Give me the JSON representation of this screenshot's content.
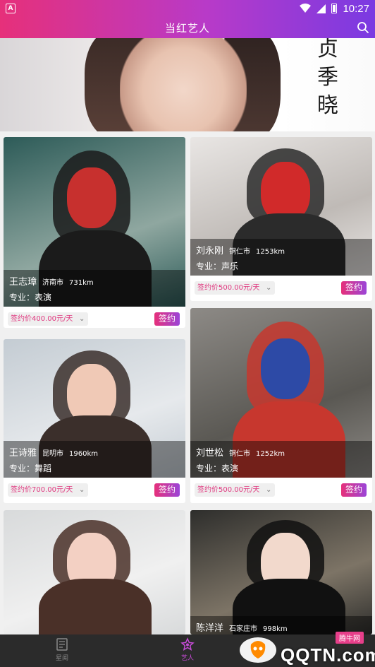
{
  "status_bar": {
    "time": "10:27"
  },
  "app_bar": {
    "title": "当红艺人"
  },
  "banner": {
    "text": "贞\n季\n晓",
    "dots": 4,
    "active_dot": 0
  },
  "cards": [
    {
      "name": "王志璋",
      "city": "济南市",
      "distance": "731km",
      "category_label": "专业：表演",
      "price": "签约价400.00元/天",
      "sign_label": "签约",
      "colors": [
        "#2d5b58",
        "#8fa7a0",
        "#c7302e",
        "#1b1b1b"
      ]
    },
    {
      "name": "刘永刚",
      "city": "铜仁市",
      "distance": "1253km",
      "category_label": "专业：声乐",
      "price": "签约价500.00元/天",
      "sign_label": "签约",
      "colors": [
        "#e9e6e4",
        "#bfbab6",
        "#d12a2a",
        "#2b2b2b"
      ]
    },
    {
      "name": "王诗雅",
      "city": "昆明市",
      "distance": "1960km",
      "category_label": "专业：舞蹈",
      "price": "签约价700.00元/天",
      "sign_label": "签约",
      "colors": [
        "#c4ccd3",
        "#e6e9ec",
        "#f0c9b6",
        "#3b2f2b"
      ]
    },
    {
      "name": "刘世松",
      "city": "铜仁市",
      "distance": "1252km",
      "category_label": "专业：表演",
      "price": "签约价500.00元/天",
      "sign_label": "签约",
      "colors": [
        "#8d8a86",
        "#5a5853",
        "#2d4aa6",
        "#c7372e"
      ]
    },
    {
      "name": "",
      "city": "",
      "distance": "",
      "category_label": "",
      "price": "",
      "sign_label": "",
      "colors": [
        "#d8dadb",
        "#f0f0f0",
        "#f3d0c3",
        "#4a3028"
      ]
    },
    {
      "name": "陈洋洋",
      "city": "石家庄市",
      "distance": "998km",
      "category_label": "",
      "price": "",
      "sign_label": "",
      "colors": [
        "#2e2e2c",
        "#7d7466",
        "#f2d9cc",
        "#111111"
      ]
    }
  ],
  "bottom_nav": [
    {
      "label": "星闻",
      "active": false
    },
    {
      "label": "艺人",
      "active": true
    },
    {
      "label": "",
      "active": false
    }
  ],
  "watermark": {
    "text": "QQTN.com",
    "tag": "腾牛网"
  }
}
